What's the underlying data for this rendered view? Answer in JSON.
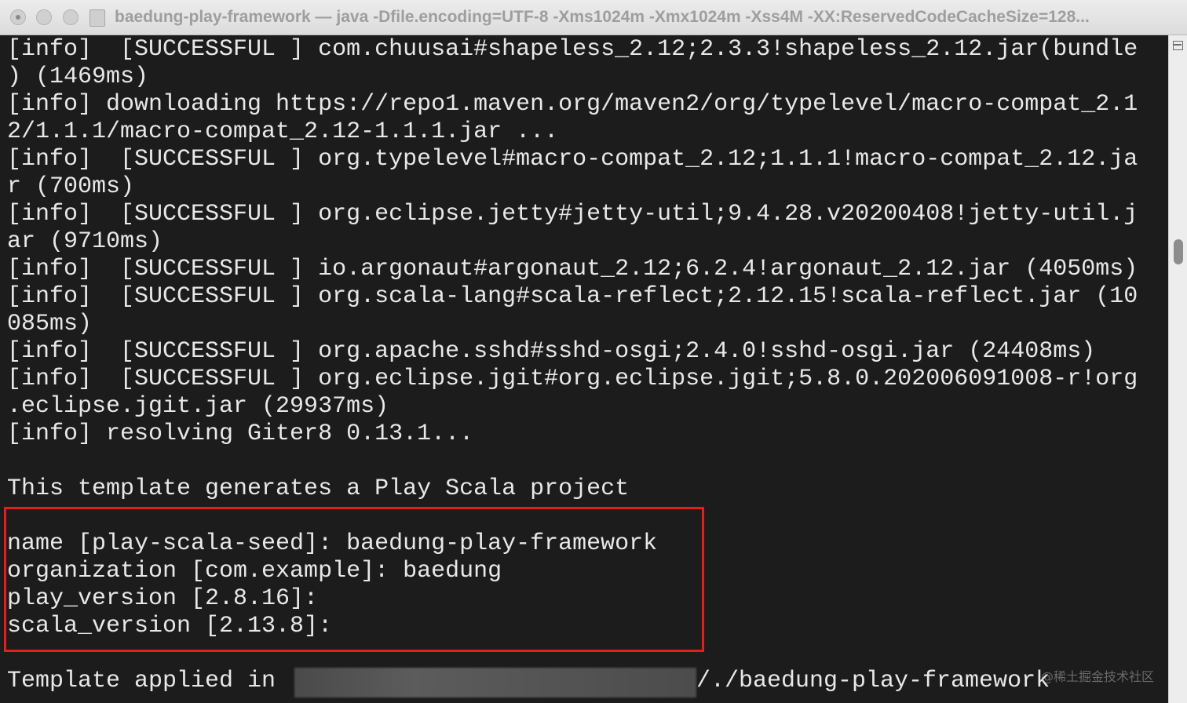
{
  "window": {
    "title": "baedung-play-framework — java -Dfile.encoding=UTF-8 -Xms1024m -Xmx1024m -Xss4M -XX:ReservedCodeCacheSize=128..."
  },
  "terminal": {
    "lines": [
      "[info]  [SUCCESSFUL ] com.chuusai#shapeless_2.12;2.3.3!shapeless_2.12.jar(bundle",
      ") (1469ms)",
      "[info] downloading https://repo1.maven.org/maven2/org/typelevel/macro-compat_2.1",
      "2/1.1.1/macro-compat_2.12-1.1.1.jar ...",
      "[info]  [SUCCESSFUL ] org.typelevel#macro-compat_2.12;1.1.1!macro-compat_2.12.ja",
      "r (700ms)",
      "[info]  [SUCCESSFUL ] org.eclipse.jetty#jetty-util;9.4.28.v20200408!jetty-util.j",
      "ar (9710ms)",
      "[info]  [SUCCESSFUL ] io.argonaut#argonaut_2.12;6.2.4!argonaut_2.12.jar (4050ms)",
      "[info]  [SUCCESSFUL ] org.scala-lang#scala-reflect;2.12.15!scala-reflect.jar (10",
      "085ms)",
      "[info]  [SUCCESSFUL ] org.apache.sshd#sshd-osgi;2.4.0!sshd-osgi.jar (24408ms)",
      "[info]  [SUCCESSFUL ] org.eclipse.jgit#org.eclipse.jgit;5.8.0.202006091008-r!org",
      ".eclipse.jgit.jar (29937ms)",
      "[info] resolving Giter8 0.13.1...",
      "",
      "This template generates a Play Scala project",
      "",
      "name [play-scala-seed]: baedung-play-framework",
      "organization [com.example]: baedung",
      "play_version [2.8.16]:",
      "scala_version [2.13.8]:",
      "",
      "Template applied in "
    ],
    "applied_path_suffix": "/./baedung-play-framework"
  },
  "watermark": "@稀土掘金技术社区",
  "colors": {
    "background": "#1c1c1c",
    "text": "#e8e8e8",
    "highlight_border": "#e02020",
    "titlebar": "#e4e4e4"
  }
}
